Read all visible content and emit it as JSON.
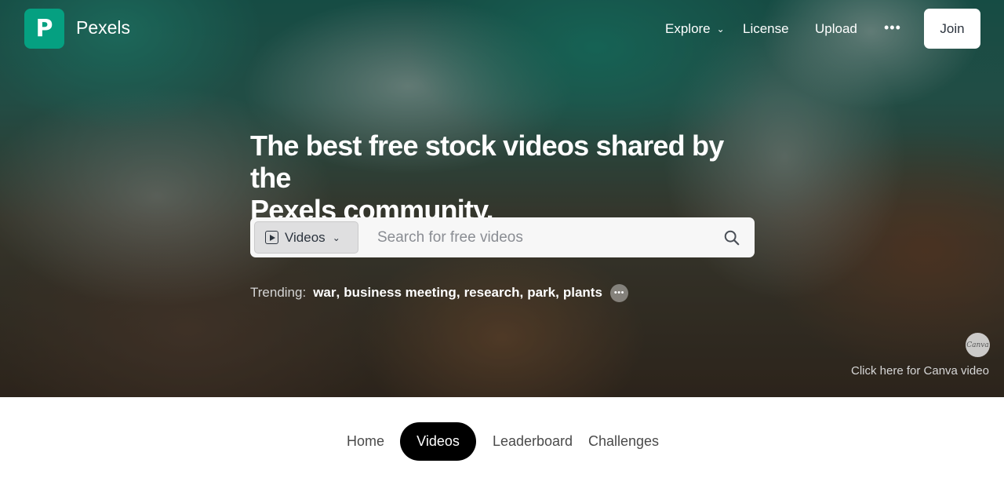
{
  "header": {
    "logo_letter": "P",
    "brand": "Pexels",
    "nav": {
      "explore": "Explore",
      "license": "License",
      "upload": "Upload",
      "more": "•••"
    },
    "join": "Join"
  },
  "hero": {
    "headline_line1": "The best free stock videos shared by the",
    "headline_line2": "Pexels community.",
    "search": {
      "type_label": "Videos",
      "placeholder": "Search for free videos"
    },
    "trending": {
      "label": "Trending:",
      "terms": [
        "war",
        "business meeting",
        "research",
        "park",
        "plants"
      ],
      "more": "•••"
    },
    "canva": {
      "badge": "Canva",
      "link": "Click here for Canva video"
    }
  },
  "tabs": {
    "home": "Home",
    "videos": "Videos",
    "leaderboard": "Leaderboard",
    "challenges": "Challenges",
    "active": "videos"
  },
  "colors": {
    "brand": "#05a081",
    "active_tab_bg": "#000000"
  }
}
